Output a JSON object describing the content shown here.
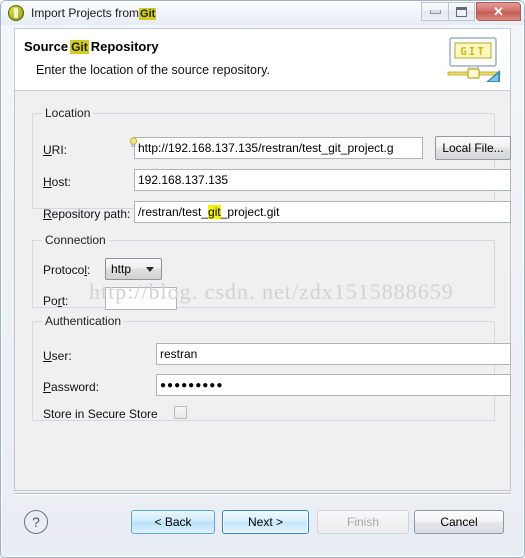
{
  "window": {
    "title_prefix": "Import Projects from ",
    "title_highlight": "Git",
    "icon": "eclipse-wizard-icon",
    "buttons": {
      "minimize": "minimize-button",
      "maximize": "maximize-button",
      "close": "✕"
    }
  },
  "header": {
    "title_before": "Source ",
    "title_highlight": "Git",
    "title_after": " Repository",
    "description": "Enter the location of the source repository.",
    "icon_label": "GIT"
  },
  "location": {
    "group_label": "Location",
    "uri_label": "URI:",
    "uri_value": "http://192.168.137.135/restran/test_git_project.g",
    "local_file_button": "Local File...",
    "host_label": "Host:",
    "host_value": "192.168.137.135",
    "repo_path_label": "Repository path:",
    "repo_path_before": "/restran/test_",
    "repo_path_highlight": "git",
    "repo_path_after": "_project.git"
  },
  "connection": {
    "group_label": "Connection",
    "protocol_label": "Protocol:",
    "protocol_value": "http",
    "port_label": "Port:",
    "port_value": ""
  },
  "authentication": {
    "group_label": "Authentication",
    "user_label": "User:",
    "user_value": "restran",
    "password_label": "Password:",
    "password_value": "●●●●●●●●●",
    "store_label": "Store in Secure Store",
    "store_checked": false
  },
  "footer": {
    "help": "?",
    "back": "< Back",
    "next": "Next >",
    "finish": "Finish",
    "cancel": "Cancel"
  },
  "watermark": "http://blog. csdn. net/zdx1515888659"
}
